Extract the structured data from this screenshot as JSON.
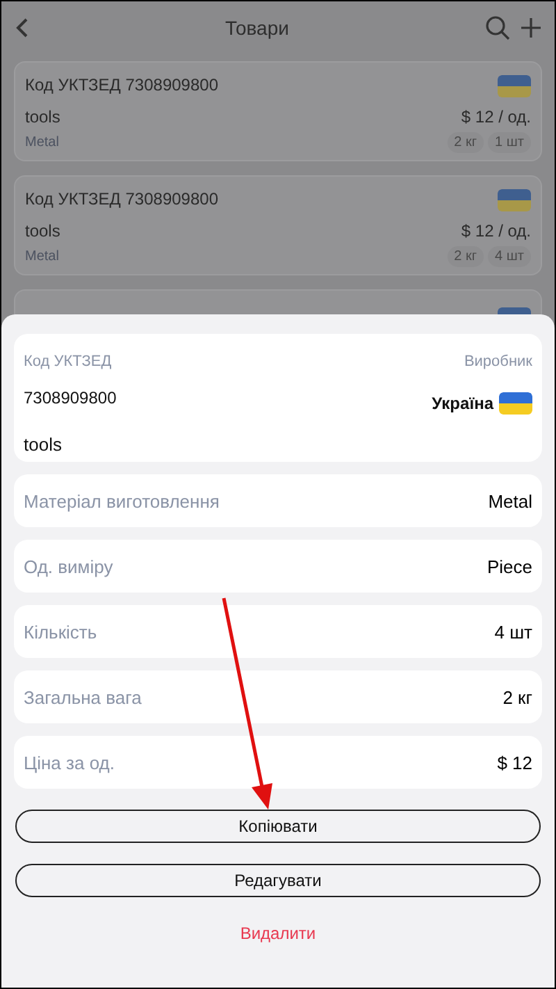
{
  "header": {
    "title": "Товари"
  },
  "products": [
    {
      "code": "Код УКТЗЕД 7308909800",
      "name": "tools",
      "price": "$ 12 / од.",
      "material": "Metal",
      "tags": [
        "2 кг",
        "1 шт"
      ]
    },
    {
      "code": "Код УКТЗЕД 7308909800",
      "name": "tools",
      "price": "$ 12 / од.",
      "material": "Metal",
      "tags": [
        "2 кг",
        "4 шт"
      ]
    }
  ],
  "sheet": {
    "code_label": "Код УКТЗЕД",
    "code": "7308909800",
    "maker_label": "Виробник",
    "maker": "Україна",
    "name": "tools",
    "fields": [
      {
        "label": "Матеріал виготовлення",
        "value": "Metal"
      },
      {
        "label": "Од. виміру",
        "value": "Piece"
      },
      {
        "label": "Кількість",
        "value": "4 шт"
      },
      {
        "label": "Загальна вага",
        "value": "2 кг"
      },
      {
        "label": "Ціна за од.",
        "value": "$ 12"
      }
    ],
    "buttons": [
      {
        "label": "Копіювати",
        "kind": "outline"
      },
      {
        "label": "Редагувати",
        "kind": "outline"
      },
      {
        "label": "Видалити",
        "kind": "danger"
      }
    ]
  }
}
